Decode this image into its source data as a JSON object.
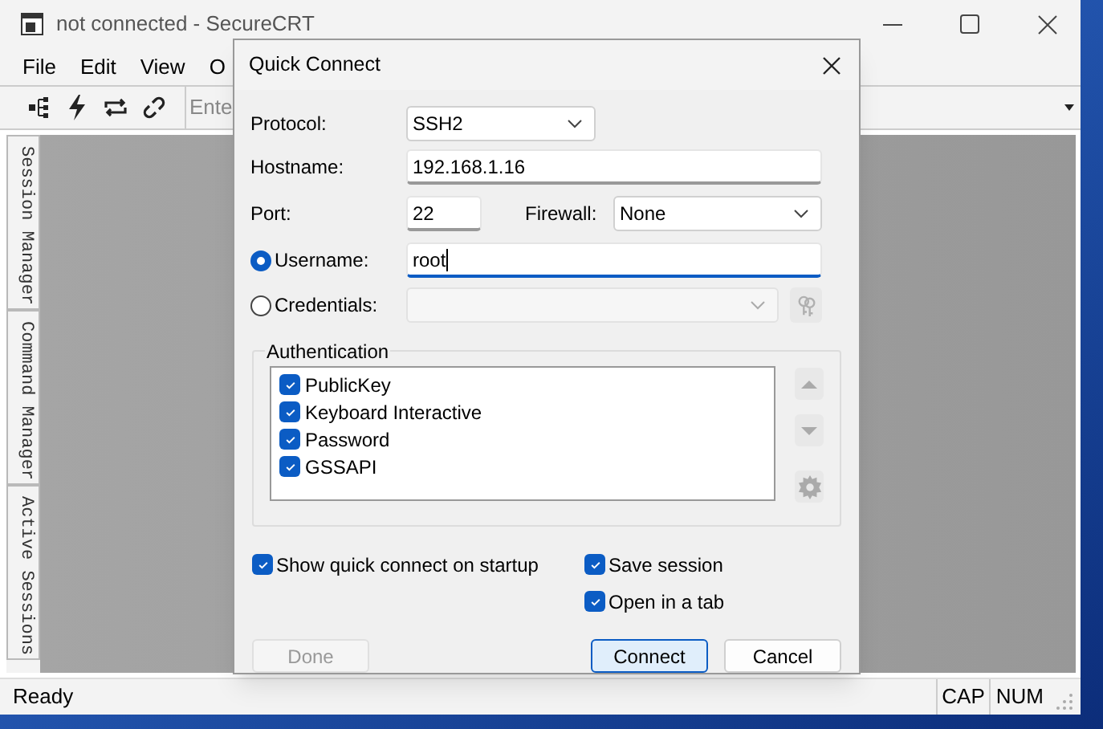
{
  "window": {
    "title": "not connected - SecureCRT"
  },
  "menu": [
    "File",
    "Edit",
    "View",
    "O"
  ],
  "toolbar": {
    "command_placeholder": "Ente"
  },
  "side_tabs": [
    "Session Manager",
    "Command Manager",
    "Active Sessions"
  ],
  "status_bar": {
    "text": "Ready",
    "indicators": [
      "CAP",
      "NUM"
    ]
  },
  "dialog": {
    "title": "Quick Connect",
    "protocol": {
      "label": "Protocol:",
      "value": "SSH2"
    },
    "hostname": {
      "label": "Hostname:",
      "value": "192.168.1.16"
    },
    "port": {
      "label": "Port:",
      "value": "22"
    },
    "firewall": {
      "label": "Firewall:",
      "value": "None"
    },
    "login": [
      {
        "label": "Username:",
        "selected": true,
        "value": "root"
      },
      {
        "label": "Credentials:",
        "selected": false,
        "disabled": true
      }
    ],
    "authentication": {
      "title": "Authentication",
      "items": [
        {
          "label": "PublicKey",
          "checked": true
        },
        {
          "label": "Keyboard Interactive",
          "checked": true
        },
        {
          "label": "Password",
          "checked": true
        },
        {
          "label": "GSSAPI",
          "checked": true
        }
      ]
    },
    "options": [
      {
        "label": "Show quick connect on startup",
        "checked": true
      },
      {
        "label": "Save session",
        "checked": true
      },
      {
        "label": "Open in a tab",
        "checked": true
      }
    ],
    "buttons": [
      {
        "label": "Done",
        "disabled": true,
        "default": false
      },
      {
        "label": "Connect",
        "disabled": false,
        "default": true
      },
      {
        "label": "Cancel",
        "disabled": false,
        "default": false
      }
    ]
  }
}
